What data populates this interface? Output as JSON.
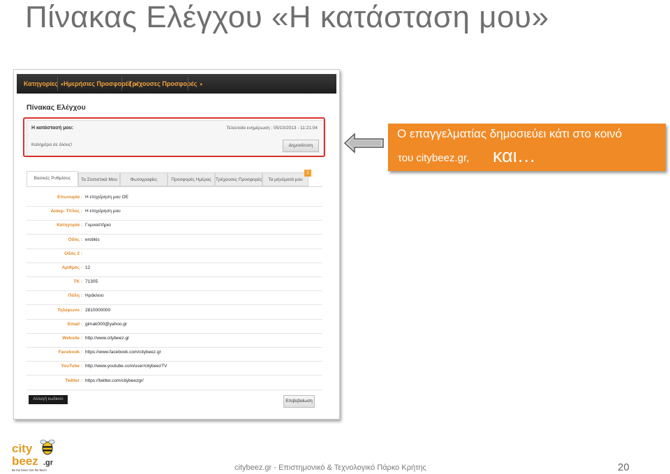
{
  "slide": {
    "title": "Πίνακας Ελέγχου «Η κατάσταση μου»",
    "footer": "citybeez.gr - Επιστημονικό & Τεχνολογικό Πάρκο Κρήτης",
    "page_number": "20"
  },
  "logo": {
    "city": "city",
    "beez": "beez",
    "gr": ".gr",
    "tagline": "Be the beez! Get the beez!"
  },
  "callout": {
    "line1": "Ο επαγγελματίας δημοσιεύει κάτι στο κοινό",
    "line2": "του citybeez.gr,",
    "line3": "και…"
  },
  "nav": {
    "items": [
      {
        "label": "Κατηγορίες"
      },
      {
        "label": "Ημερήσιες Προσφορές"
      },
      {
        "label": "Τρέχουσες Προσφορές"
      }
    ]
  },
  "panel": {
    "title": "Πίνακας Ελέγχου"
  },
  "status": {
    "label": "Η κατάστασή μου:",
    "updated": "Τελευταία ενημέρωση :   05/10/2013 - 11:21:04",
    "text": "Καλημέρα σε όλους!",
    "publish_label": "Δημοσίευση"
  },
  "tabs": [
    {
      "label": "Βασικές Ρυθμίσεις"
    },
    {
      "label": "Τα Στατιστικά Μου"
    },
    {
      "label": "Φωτογραφίες"
    },
    {
      "label": "Προσφορές Ημέρας"
    },
    {
      "label": "Τρέχουσες Προσφορές"
    },
    {
      "label": "Τα μηνύματά μου"
    }
  ],
  "tab_badge": "2",
  "form": [
    {
      "label": "Επωνυμία :",
      "value": "Η επιχείρηση μου ΟΕ"
    },
    {
      "label": "Διακρ. Τίτλος :",
      "value": "Η επιχείρηση μου"
    },
    {
      "label": "Κατηγορία :",
      "value": "Γυμναστήριο"
    },
    {
      "label": "Οδός :",
      "value": "erotikis"
    },
    {
      "label": "Οδός 2 :",
      "value": ""
    },
    {
      "label": "Αριθμός :",
      "value": "12"
    },
    {
      "label": "ΤΚ :",
      "value": "71305"
    },
    {
      "label": "Πόλη :",
      "value": "Ηράκλειο"
    },
    {
      "label": "Τηλέφωνο :",
      "value": "2810000000"
    },
    {
      "label": "Email :",
      "value": "gimak000@yahoo.gr"
    },
    {
      "label": "Website :",
      "value": "http://www.citybeez.gr"
    },
    {
      "label": "Facebook :",
      "value": "https://www.facebook.com/citybeez.gr"
    },
    {
      "label": "YouTube :",
      "value": "http://www.youtube.com/user/citybeezTV"
    },
    {
      "label": "Twitter :",
      "value": "https://twitter.com/citybeezgr/"
    }
  ],
  "buttons": {
    "change_password": "Αλλαγή κωδικού",
    "confirm": "Επιβεβαίωση"
  },
  "colors": {
    "callout_bg": "#f08a26",
    "nav_text": "#f2a23a",
    "highlight": "#d9302c",
    "label_orange": "#e08a2a"
  }
}
